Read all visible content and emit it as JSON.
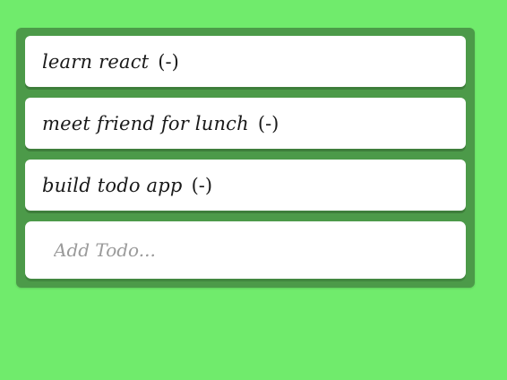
{
  "todos": [
    {
      "text": "learn react",
      "remove_label": "(-)"
    },
    {
      "text": "meet friend for lunch",
      "remove_label": "(-)"
    },
    {
      "text": "build todo app",
      "remove_label": "(-)"
    }
  ],
  "add_input": {
    "placeholder": "Add Todo...",
    "value": ""
  },
  "colors": {
    "background": "#70eb6c",
    "panel": "#4c9a49",
    "card": "#ffffff"
  }
}
